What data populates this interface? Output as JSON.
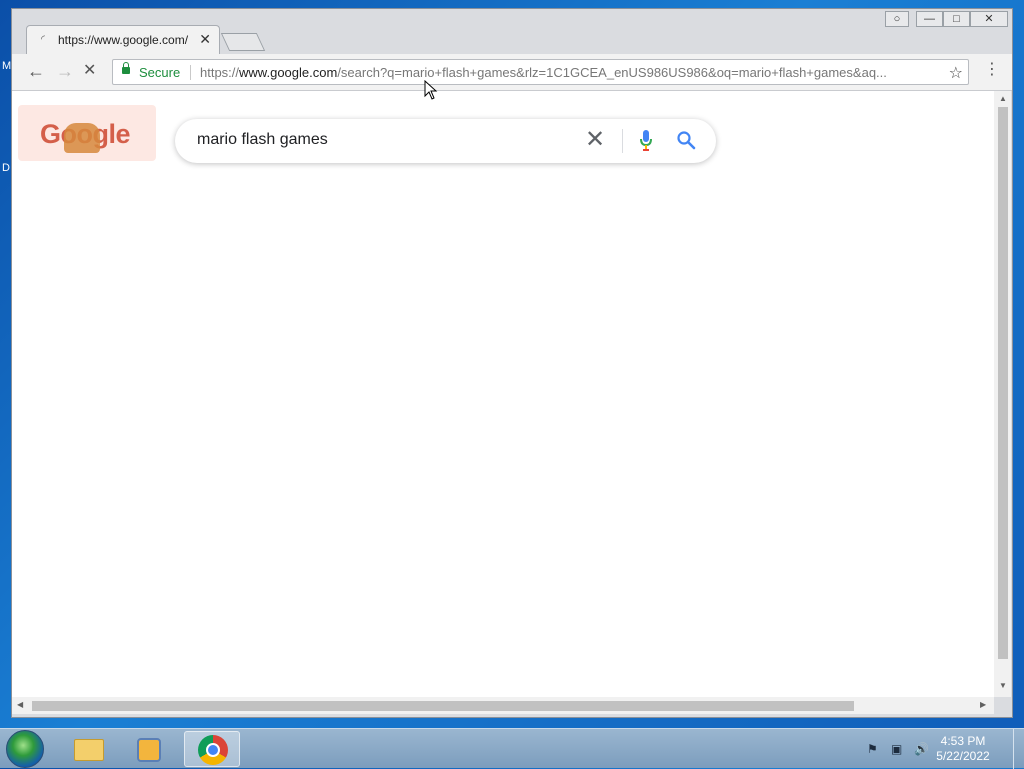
{
  "desktop": {
    "frag1": "M",
    "frag2": "D"
  },
  "browser": {
    "tab_title": "https://www.google.com/",
    "tab_close": "✕",
    "window_controls": {
      "user": "○",
      "minimize": "—",
      "maximize": "□",
      "close": "✕"
    },
    "nav": {
      "back": "←",
      "forward": "→",
      "stop": "✕"
    },
    "omnibox": {
      "secure_label": "Secure",
      "url_scheme": "https://",
      "url_host": "www.google.com",
      "url_path": "/search?q=mario+flash+games&rlz=1C1GCEA_enUS986US986&oq=mario+flash+games&aq..."
    },
    "star": "☆",
    "menu": "⋮"
  },
  "page": {
    "doodle_text": "Google",
    "search": {
      "query": "mario flash games",
      "clear_icon": "✕"
    }
  },
  "taskbar": {
    "clock_time": "4:53 PM",
    "clock_date": "5/22/2022",
    "tray_icons": [
      "action-center-icon",
      "network-icon",
      "volume-icon"
    ]
  },
  "colors": {
    "secure_green": "#1e8e3e",
    "google_blue": "#4285f4",
    "google_red": "#ea4335",
    "google_yellow": "#fbbc05",
    "google_green": "#34a853"
  }
}
